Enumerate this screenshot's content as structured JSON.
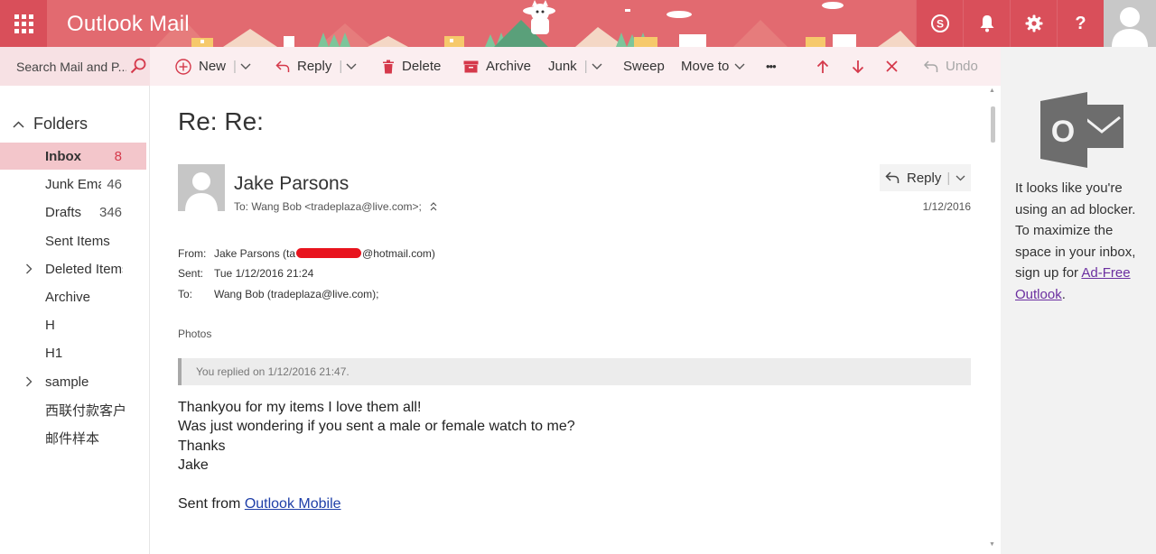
{
  "header": {
    "app_title": "Outlook Mail",
    "icons": [
      "waffle-icon",
      "skype-icon",
      "bell-icon",
      "gear-icon",
      "help-icon",
      "avatar"
    ],
    "help_glyph": "?"
  },
  "search": {
    "placeholder": "Search Mail and P..."
  },
  "toolbar": {
    "new_label": "New",
    "reply_label": "Reply",
    "delete_label": "Delete",
    "archive_label": "Archive",
    "junk_label": "Junk",
    "sweep_label": "Sweep",
    "move_label": "Move to",
    "more_label": "•••",
    "undo_label": "Undo"
  },
  "nav": {
    "folders_label": "Folders",
    "items": [
      {
        "label": "Inbox",
        "count": "8"
      },
      {
        "label": "Junk Ema",
        "count": "46"
      },
      {
        "label": "Drafts",
        "count": "346"
      },
      {
        "label": "Sent Items",
        "count": ""
      },
      {
        "label": "Deleted Items",
        "count": ""
      },
      {
        "label": "Archive",
        "count": ""
      },
      {
        "label": "H",
        "count": ""
      },
      {
        "label": "H1",
        "count": ""
      },
      {
        "label": "sample",
        "count": ""
      },
      {
        "label": "西联付款客户",
        "count": ""
      },
      {
        "label": "邮件样本",
        "count": ""
      }
    ]
  },
  "message": {
    "subject": "Re: Re:",
    "sender_name": "Jake Parsons",
    "to_line": "To: Wang Bob <tradeplaza@live.com>;",
    "reply_label": "Reply",
    "date": "1/12/2016",
    "from_label": "From:",
    "from_prefix": "Jake Parsons (ta",
    "from_suffix": "@hotmail.com)",
    "sent_label": "Sent:",
    "sent_value": "Tue 1/12/2016 21:24",
    "to_label": "To:",
    "to_value": "Wang Bob (tradeplaza@live.com);",
    "photos_label": "Photos",
    "replied_note": "You replied on 1/12/2016 21:47.",
    "body_lines": [
      "Thankyou for my items I love them all!",
      "Was just wondering if you sent a male or female watch to me?",
      "Thanks",
      "Jake"
    ],
    "sent_from_prefix": "Sent from ",
    "sent_from_link": "Outlook Mobile"
  },
  "ad_pane": {
    "text": "It looks like you're using an ad blocker. To maximize the space in your inbox, sign up for ",
    "link": "Ad-Free Outlook",
    "suffix": ".",
    "logo_letter": "O"
  },
  "colors": {
    "header_bg": "#e2606a",
    "selected_folder": "#f3c6cb",
    "unread_count": "#d5394b",
    "link": "#1f3fa8"
  }
}
